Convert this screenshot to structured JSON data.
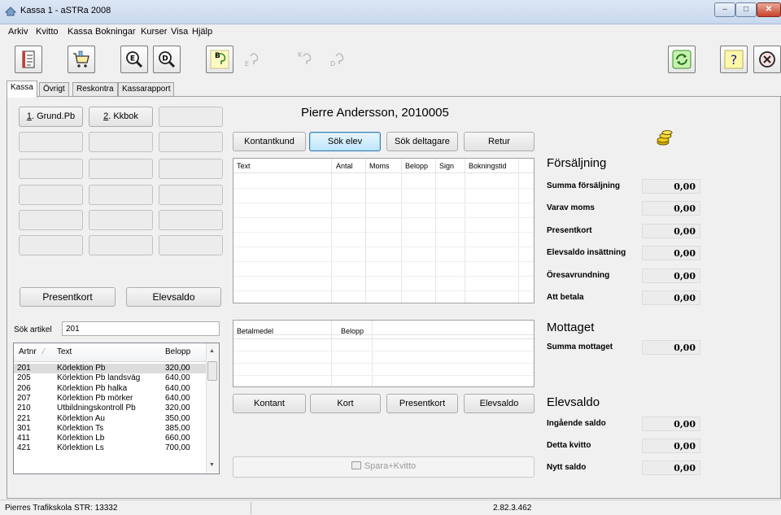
{
  "window": {
    "title": "Kassa 1 - aSTRa 2008",
    "controls": {
      "minimize": "–",
      "maximize": "□",
      "close": "✕"
    }
  },
  "menu": [
    "Arkiv",
    "Kvitto",
    "Kassa",
    "Bokningar",
    "Kurser",
    "Visa",
    "Hjälp"
  ],
  "toolbar": {
    "b_label": "B",
    "e_label": "E",
    "k_label": "K",
    "d_label": "D",
    "help_label": "?"
  },
  "tabs": [
    "Kassa",
    "Övrigt",
    "Reskontra",
    "Kassarapport"
  ],
  "quick_buttons": {
    "grund": "1. Grund.Pb",
    "kkbok": "2. Kkbok"
  },
  "left_actions": {
    "presentkort": "Presentkort",
    "elevsaldo": "Elevsaldo"
  },
  "search": {
    "label": "Sök artikel",
    "value": "201"
  },
  "articles": {
    "columns": [
      "Artnr",
      "Text",
      "Belopp"
    ],
    "rows": [
      {
        "artnr": "201",
        "text": "Körlektion Pb",
        "belopp": "320,00",
        "selected": true
      },
      {
        "artnr": "205",
        "text": "Körlektion Pb landsväg",
        "belopp": "640,00"
      },
      {
        "artnr": "206",
        "text": "Körlektion Pb halka",
        "belopp": "640,00"
      },
      {
        "artnr": "207",
        "text": "Körlektion Pb mörker",
        "belopp": "640,00"
      },
      {
        "artnr": "210",
        "text": "Utbildningskontroll Pb",
        "belopp": "320,00"
      },
      {
        "artnr": "221",
        "text": "Körlektion Au",
        "belopp": "350,00"
      },
      {
        "artnr": "301",
        "text": "Körlektion Ts",
        "belopp": "385,00"
      },
      {
        "artnr": "411",
        "text": "Körlektion Lb",
        "belopp": "660,00"
      },
      {
        "artnr": "421",
        "text": "Körlektion Ls",
        "belopp": "700,00"
      }
    ]
  },
  "customer": {
    "name": "Pierre Andersson, 2010005"
  },
  "customer_buttons": {
    "kontantkund": "Kontantkund",
    "sok_elev": "Sök elev",
    "sok_deltagare": "Sök deltagare",
    "retur": "Retur"
  },
  "sales_table": {
    "columns": [
      "Text",
      "Antal",
      "Moms",
      "Belopp",
      "Sign",
      "Bokningstid"
    ]
  },
  "payment_table": {
    "columns": [
      "Betalmedel",
      "Belopp"
    ]
  },
  "payment_buttons": {
    "kontant": "Kontant",
    "kort": "Kort",
    "presentkort": "Presentkort",
    "elevsaldo": "Elevsaldo"
  },
  "save_button": "Spara+Kvitto",
  "forsaljning": {
    "title": "Försäljning",
    "rows": [
      {
        "label": "Summa försäljning",
        "value": "0,00"
      },
      {
        "label": "Varav moms",
        "value": "0,00"
      },
      {
        "label": "Presentkort",
        "value": "0,00"
      },
      {
        "label": "Elevsaldo insättning",
        "value": "0,00"
      },
      {
        "label": "Öresavrundning",
        "value": "0,00"
      },
      {
        "label": "Att betala",
        "value": "0,00"
      }
    ]
  },
  "mottaget": {
    "title": "Mottaget",
    "rows": [
      {
        "label": "Summa mottaget",
        "value": "0,00"
      }
    ]
  },
  "elevsaldo": {
    "title": "Elevsaldo",
    "rows": [
      {
        "label": "Ingående saldo",
        "value": "0,00"
      },
      {
        "label": "Detta kvitto",
        "value": "0,00"
      },
      {
        "label": "Nytt saldo",
        "value": "0,00"
      }
    ]
  },
  "status": {
    "left": "Pierres Trafikskola STR: 13332",
    "version": "2.82.3.462"
  },
  "colors": {
    "accent": "#3c7fb1",
    "close": "#c7432b"
  }
}
